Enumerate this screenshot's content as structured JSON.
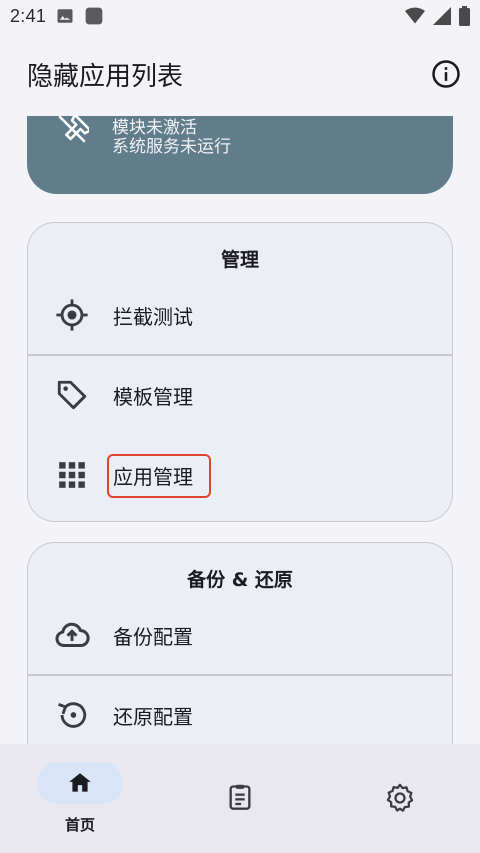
{
  "status_bar": {
    "time": "2:41",
    "icons": [
      "gallery-icon",
      "app-notification-icon",
      "wifi-icon",
      "cellular-signal-icon",
      "battery-icon"
    ]
  },
  "top_bar": {
    "title": "隐藏应用列表",
    "info_icon": "info-icon"
  },
  "status_card": {
    "title": "模块未激活",
    "subtitle": "系统服务未运行",
    "icon": "module-inactive-icon",
    "color": "#617d8b"
  },
  "manage_group": {
    "title": "管理",
    "items": [
      {
        "label": "拦截测试",
        "icon": "crosshair-icon"
      },
      {
        "label": "模板管理",
        "icon": "tag-icon"
      },
      {
        "label": "应用管理",
        "icon": "apps-grid-icon"
      }
    ]
  },
  "backup_group": {
    "title": "备份 & 还原",
    "items": [
      {
        "label": "备份配置",
        "icon": "cloud-upload-icon"
      },
      {
        "label": "还原配置",
        "icon": "restore-icon"
      }
    ]
  },
  "bottom_nav": {
    "items": [
      {
        "label": "首页",
        "icon": "home-icon",
        "selected": true
      },
      {
        "label": "",
        "icon": "clipboard-log-icon",
        "selected": false
      },
      {
        "label": "",
        "icon": "settings-icon",
        "selected": false
      }
    ]
  },
  "colors": {
    "background": "#f4f3f8",
    "card": "#eceef6",
    "accent_pill": "#d8e4f7",
    "highlight_border": "#e0452e"
  }
}
